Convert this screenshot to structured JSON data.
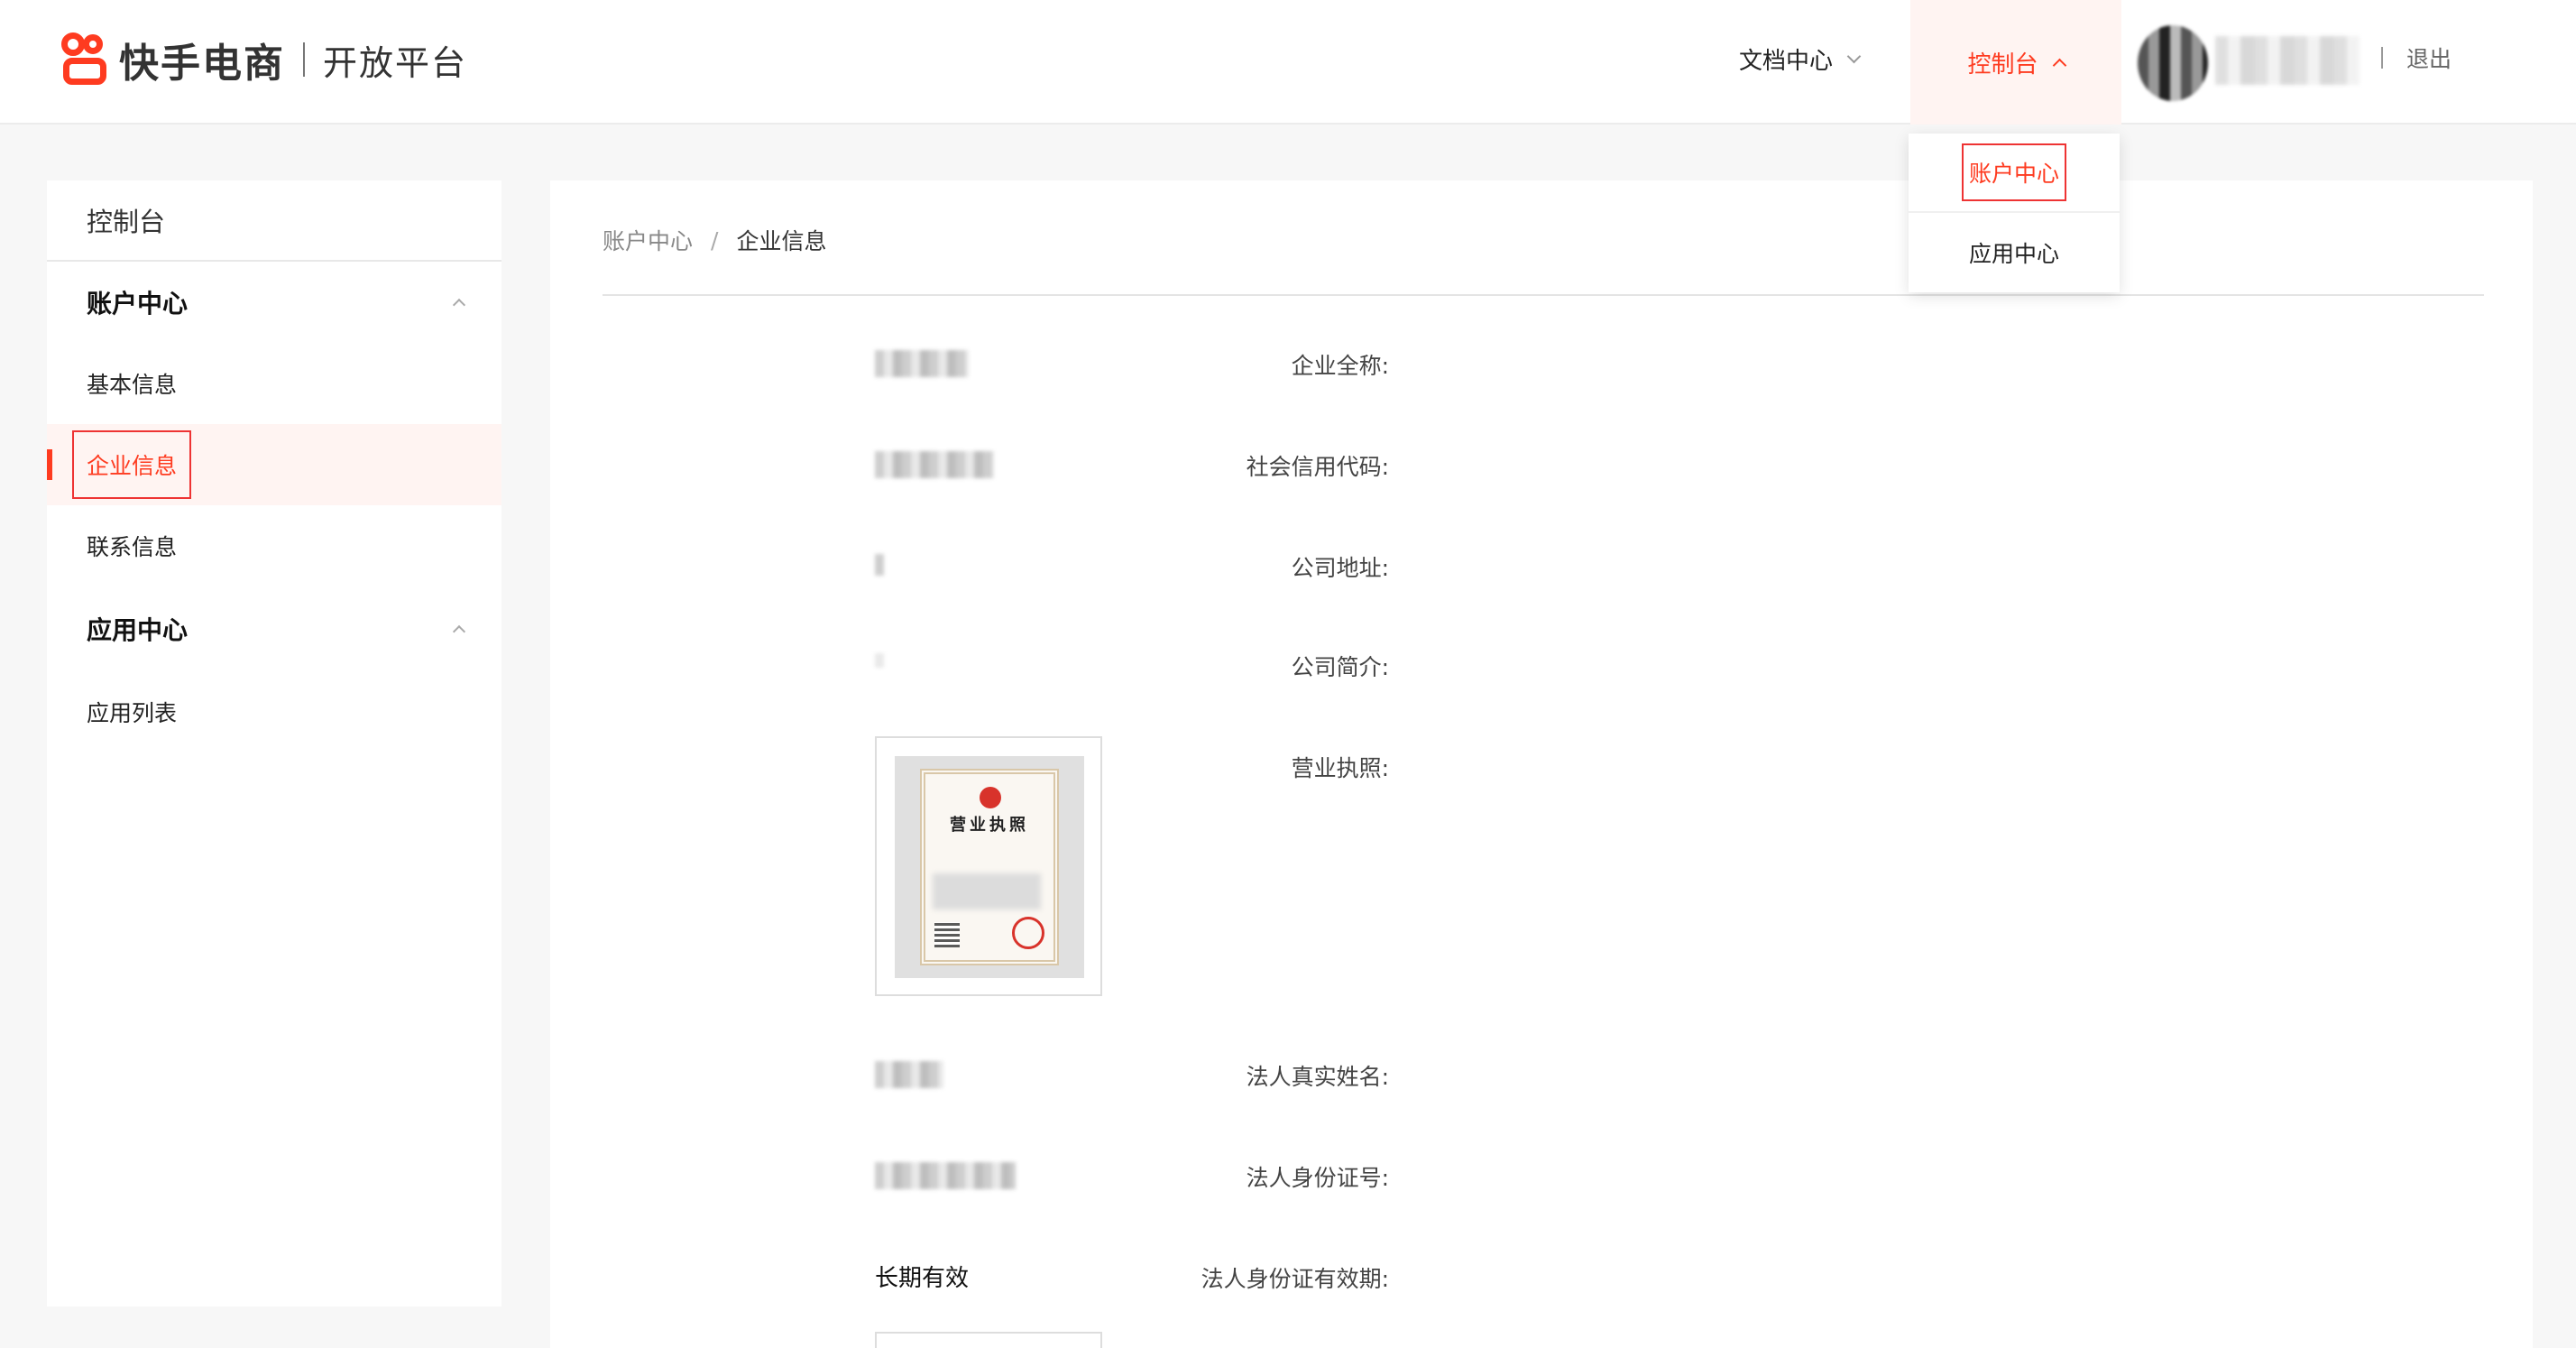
{
  "header": {
    "brand": "快手电商",
    "platform": "开放平台",
    "nav_docs": "文档中心",
    "nav_console": "控制台",
    "logout": "退出"
  },
  "dropdown": {
    "items": [
      "账户中心",
      "应用中心"
    ]
  },
  "sidebar": {
    "title": "控制台",
    "groups": [
      {
        "label": "账户中心",
        "items": [
          "基本信息",
          "企业信息",
          "联系信息"
        ]
      },
      {
        "label": "应用中心",
        "items": [
          "应用列表"
        ]
      }
    ],
    "active_item": "企业信息"
  },
  "breadcrumb": {
    "parent": "账户中心",
    "separator": "/",
    "current": "企业信息"
  },
  "fields": {
    "company_name": "企业全称:",
    "credit_code": "社会信用代码:",
    "address": "公司地址:",
    "intro": "公司简介:",
    "license": "营业执照:",
    "legal_name": "法人真实姓名:",
    "legal_id": "法人身份证号:",
    "id_validity": "法人身份证有效期:"
  },
  "values": {
    "id_validity": "长期有效"
  },
  "license_image": {
    "title": "营业执照"
  },
  "colors": {
    "accent": "#fe3b20",
    "active_bg": "#fff4f2",
    "page_bg": "#f7f7f7"
  }
}
